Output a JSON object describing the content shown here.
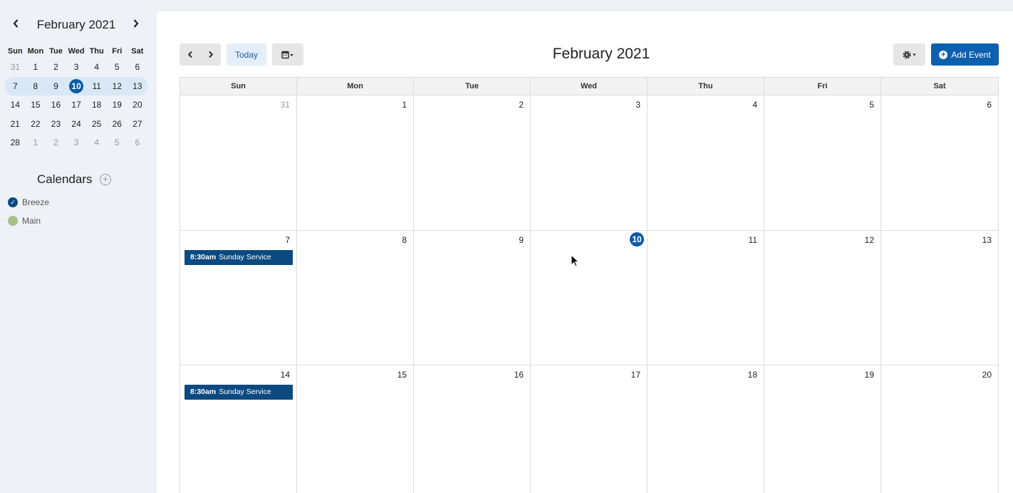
{
  "sidebar": {
    "mini_title": "February 2021",
    "prev_icon": "chevron-left-icon",
    "next_icon": "chevron-right-icon",
    "dow": [
      "Sun",
      "Mon",
      "Tue",
      "Wed",
      "Thu",
      "Fri",
      "Sat"
    ],
    "weeks": [
      [
        "31",
        "1",
        "2",
        "3",
        "4",
        "5",
        "6"
      ],
      [
        "7",
        "8",
        "9",
        "10",
        "11",
        "12",
        "13"
      ],
      [
        "14",
        "15",
        "16",
        "17",
        "18",
        "19",
        "20"
      ],
      [
        "21",
        "22",
        "23",
        "24",
        "25",
        "26",
        "27"
      ],
      [
        "28",
        "1",
        "2",
        "3",
        "4",
        "5",
        "6"
      ]
    ],
    "calendars_heading": "Calendars",
    "calendars": [
      {
        "label": "Breeze",
        "color": "#0b4a80",
        "checked": true
      },
      {
        "label": "Main",
        "color": "#a9bf86",
        "checked": false
      }
    ]
  },
  "toolbar": {
    "today_label": "Today",
    "title": "February 2021",
    "add_event_label": "Add Event",
    "view_icon": "calendar-icon",
    "settings_icon": "gear-icon"
  },
  "grid": {
    "dow": [
      "Sun",
      "Mon",
      "Tue",
      "Wed",
      "Thu",
      "Fri",
      "Sat"
    ],
    "weeks": [
      [
        "31",
        "1",
        "2",
        "3",
        "4",
        "5",
        "6"
      ],
      [
        "7",
        "8",
        "9",
        "10",
        "11",
        "12",
        "13"
      ],
      [
        "14",
        "15",
        "16",
        "17",
        "18",
        "19",
        "20"
      ]
    ],
    "today": "10",
    "events": [
      {
        "week": 1,
        "day": 0,
        "time": "8:30am",
        "title": "Sunday Service"
      },
      {
        "week": 2,
        "day": 0,
        "time": "8:30am",
        "title": "Sunday Service"
      }
    ]
  },
  "colors": {
    "accent": "#0d5fb0",
    "event": "#0b4a80",
    "today": "#0a5ba8"
  }
}
